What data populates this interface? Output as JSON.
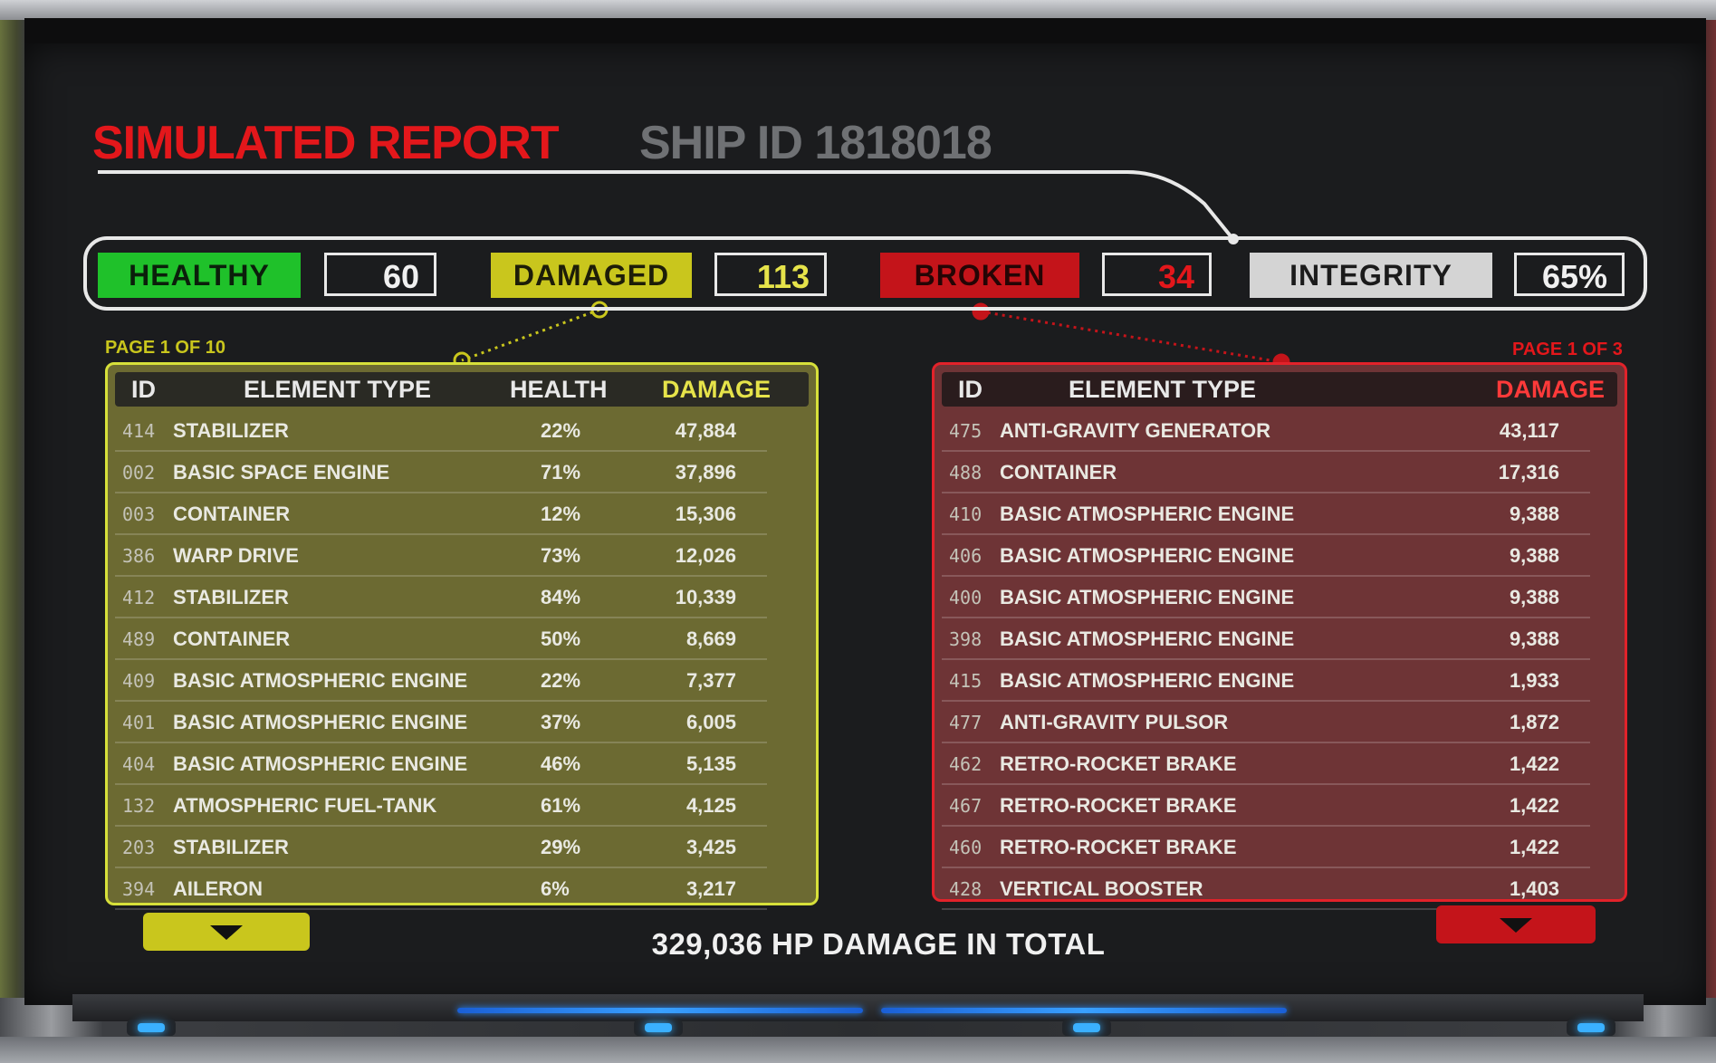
{
  "header": {
    "title": "SIMULATED REPORT",
    "subtitle": "SHIP ID 1818018"
  },
  "status": {
    "healthy_label": "HEALTHY",
    "healthy_count": "60",
    "damaged_label": "DAMAGED",
    "damaged_count": "113",
    "broken_label": "BROKEN",
    "broken_count": "34",
    "integrity_label": "INTEGRITY",
    "integrity_value": "65%"
  },
  "colors": {
    "healthy": "#1fc12a",
    "damaged": "#c9c61d",
    "broken": "#c4141a",
    "integrity": "#d4d4d4",
    "accent_red": "#e3171b"
  },
  "damaged_table": {
    "page_label": "PAGE 1 OF 10",
    "columns": {
      "id": "ID",
      "type": "ELEMENT TYPE",
      "health": "HEALTH",
      "damage": "DAMAGE"
    },
    "rows": [
      {
        "id": "414",
        "type": "STABILIZER",
        "health": "22%",
        "damage": "47,884"
      },
      {
        "id": "002",
        "type": "BASIC SPACE ENGINE",
        "health": "71%",
        "damage": "37,896"
      },
      {
        "id": "003",
        "type": "CONTAINER",
        "health": "12%",
        "damage": "15,306"
      },
      {
        "id": "386",
        "type": "WARP DRIVE",
        "health": "73%",
        "damage": "12,026"
      },
      {
        "id": "412",
        "type": "STABILIZER",
        "health": "84%",
        "damage": "10,339"
      },
      {
        "id": "489",
        "type": "CONTAINER",
        "health": "50%",
        "damage": "8,669"
      },
      {
        "id": "409",
        "type": "BASIC ATMOSPHERIC ENGINE",
        "health": "22%",
        "damage": "7,377"
      },
      {
        "id": "401",
        "type": "BASIC ATMOSPHERIC ENGINE",
        "health": "37%",
        "damage": "6,005"
      },
      {
        "id": "404",
        "type": "BASIC ATMOSPHERIC ENGINE",
        "health": "46%",
        "damage": "5,135"
      },
      {
        "id": "132",
        "type": "ATMOSPHERIC FUEL-TANK",
        "health": "61%",
        "damage": "4,125"
      },
      {
        "id": "203",
        "type": "STABILIZER",
        "health": "29%",
        "damage": "3,425"
      },
      {
        "id": "394",
        "type": "AILERON",
        "health": "6%",
        "damage": "3,217"
      }
    ]
  },
  "broken_table": {
    "page_label": "PAGE 1 OF 3",
    "columns": {
      "id": "ID",
      "type": "ELEMENT TYPE",
      "damage": "DAMAGE"
    },
    "rows": [
      {
        "id": "475",
        "type": "ANTI-GRAVITY GENERATOR",
        "damage": "43,117"
      },
      {
        "id": "488",
        "type": "CONTAINER",
        "damage": "17,316"
      },
      {
        "id": "410",
        "type": "BASIC ATMOSPHERIC ENGINE",
        "damage": "9,388"
      },
      {
        "id": "406",
        "type": "BASIC ATMOSPHERIC ENGINE",
        "damage": "9,388"
      },
      {
        "id": "400",
        "type": "BASIC ATMOSPHERIC ENGINE",
        "damage": "9,388"
      },
      {
        "id": "398",
        "type": "BASIC ATMOSPHERIC ENGINE",
        "damage": "9,388"
      },
      {
        "id": "415",
        "type": "BASIC ATMOSPHERIC ENGINE",
        "damage": "1,933"
      },
      {
        "id": "477",
        "type": "ANTI-GRAVITY PULSOR",
        "damage": "1,872"
      },
      {
        "id": "462",
        "type": "RETRO-ROCKET BRAKE",
        "damage": "1,422"
      },
      {
        "id": "467",
        "type": "RETRO-ROCKET BRAKE",
        "damage": "1,422"
      },
      {
        "id": "460",
        "type": "RETRO-ROCKET BRAKE",
        "damage": "1,422"
      },
      {
        "id": "428",
        "type": "VERTICAL BOOSTER",
        "damage": "1,403"
      }
    ]
  },
  "footer": {
    "total": "329,036 HP DAMAGE IN TOTAL",
    "next_icon": "chevron-down-icon"
  }
}
